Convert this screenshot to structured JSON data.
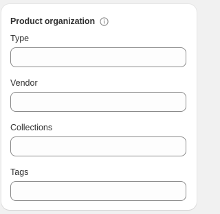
{
  "card": {
    "title": "Product organization",
    "info_icon": "info-circle-icon"
  },
  "fields": {
    "type": {
      "label": "Type",
      "value": "",
      "placeholder": ""
    },
    "vendor": {
      "label": "Vendor",
      "value": "",
      "placeholder": ""
    },
    "collections": {
      "label": "Collections",
      "value": "",
      "placeholder": ""
    },
    "tags": {
      "label": "Tags",
      "value": "",
      "placeholder": ""
    }
  },
  "colors": {
    "text": "#303030",
    "border": "#8a8a8a",
    "card_bg": "#ffffff",
    "page_bg": "#f1f1f1"
  }
}
